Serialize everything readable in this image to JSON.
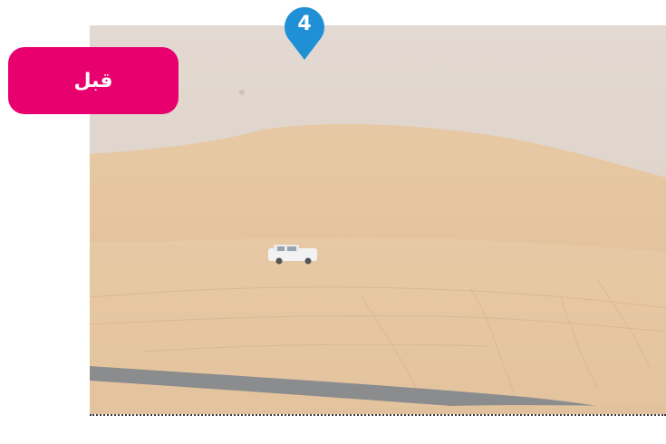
{
  "badge": {
    "label": "قبل",
    "color": "#e8006f"
  },
  "step_marker": {
    "number": "4",
    "color": "#1f8fd6"
  },
  "photo": {
    "subject": "sandstorm-desert-dunes-with-white-suv"
  }
}
